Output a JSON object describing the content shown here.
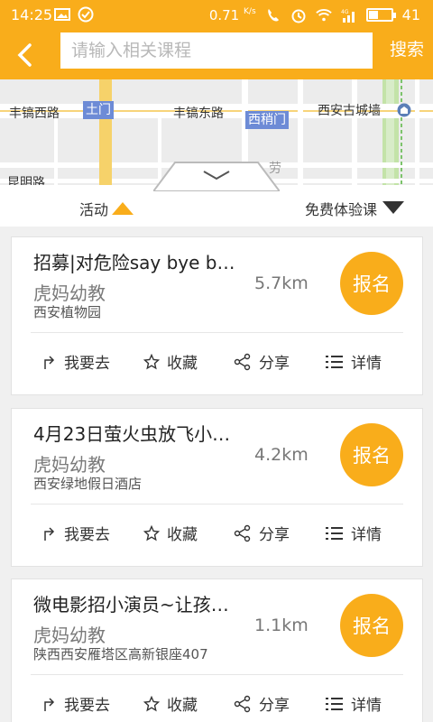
{
  "status_bar": {
    "time": "14:25",
    "speed": "0.71",
    "speed_unit": "K/s",
    "signal_label": "4G",
    "battery_level": "41"
  },
  "header": {
    "search_placeholder": "请输入相关课程",
    "search_label": "搜索"
  },
  "map": {
    "labels": [
      {
        "text": "丰镐西路",
        "style": "plain"
      },
      {
        "text": "土门",
        "style": "tag"
      },
      {
        "text": "丰镐东路",
        "style": "plain"
      },
      {
        "text": "西稍门",
        "style": "tag"
      },
      {
        "text": "西安古城墙",
        "style": "plain"
      },
      {
        "text": "昆明路",
        "style": "plain"
      },
      {
        "text": "劳",
        "style": "plain"
      }
    ]
  },
  "tabs": {
    "left_label": "活动",
    "right_label": "免费体验课"
  },
  "actions": {
    "go": "我要去",
    "favorite": "收藏",
    "share": "分享",
    "detail": "详情"
  },
  "signup_label": "报名",
  "cards": [
    {
      "title": "招募|对危险say bye b…",
      "org": "虎妈幼教",
      "address": "西安植物园",
      "distance": "5.7km"
    },
    {
      "title": "4月23日萤火虫放飞小…",
      "org": "虎妈幼教",
      "address": "西安绿地假日酒店",
      "distance": "4.2km"
    },
    {
      "title": "微电影招小演员~让孩…",
      "org": "虎妈幼教",
      "address": "陕西西安雁塔区高新银座407",
      "distance": "1.1km"
    }
  ],
  "colors": {
    "accent": "#f9ad1b"
  }
}
